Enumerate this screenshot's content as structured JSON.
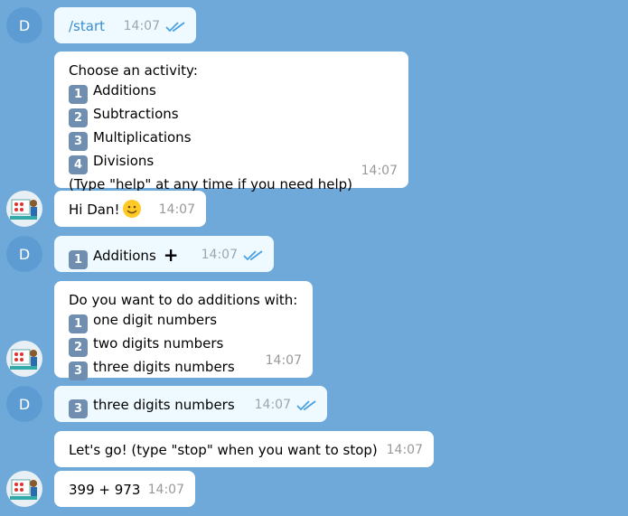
{
  "user_initial": "D",
  "messages": [
    {
      "id": "m1",
      "dir": "out",
      "text": "/start",
      "time": "14:07"
    },
    {
      "id": "m2",
      "dir": "in",
      "lines": [
        {
          "text": "Choose an activity:"
        },
        {
          "num": "1",
          "text": "Additions"
        },
        {
          "num": "2",
          "text": "Subtractions"
        },
        {
          "num": "3",
          "text": "Multiplications"
        },
        {
          "num": "4",
          "text": "Divisions"
        },
        {
          "text": "(Type \"help\" at any time if you need help)"
        }
      ],
      "time": "14:07"
    },
    {
      "id": "m3",
      "dir": "in",
      "text": "Hi Dan!",
      "emoji": "smiling-face",
      "time": "14:07"
    },
    {
      "id": "m4",
      "dir": "out",
      "num": "1",
      "text": "Additions",
      "emoji": "heavy-plus",
      "time": "14:07"
    },
    {
      "id": "m5",
      "dir": "in",
      "lines": [
        {
          "text": "Do you want to do additions with:"
        },
        {
          "num": "1",
          "text": "one digit numbers"
        },
        {
          "num": "2",
          "text": "two digits numbers"
        },
        {
          "num": "3",
          "text": "three digits numbers"
        }
      ],
      "time": "14:07"
    },
    {
      "id": "m6",
      "dir": "out",
      "num": "3",
      "text": "three digits numbers",
      "time": "14:07"
    },
    {
      "id": "m7",
      "dir": "in",
      "text": "Let's go! (type \"stop\" when you want to stop)",
      "time": "14:07"
    },
    {
      "id": "m8",
      "dir": "in",
      "text": "399 + 973",
      "time": "14:07"
    }
  ],
  "colors": {
    "background": "#6fa9d9",
    "outgoing": "#eefaff",
    "incoming": "#ffffff",
    "avatar": "#5d9bd3",
    "check": "#4aa0e0"
  }
}
